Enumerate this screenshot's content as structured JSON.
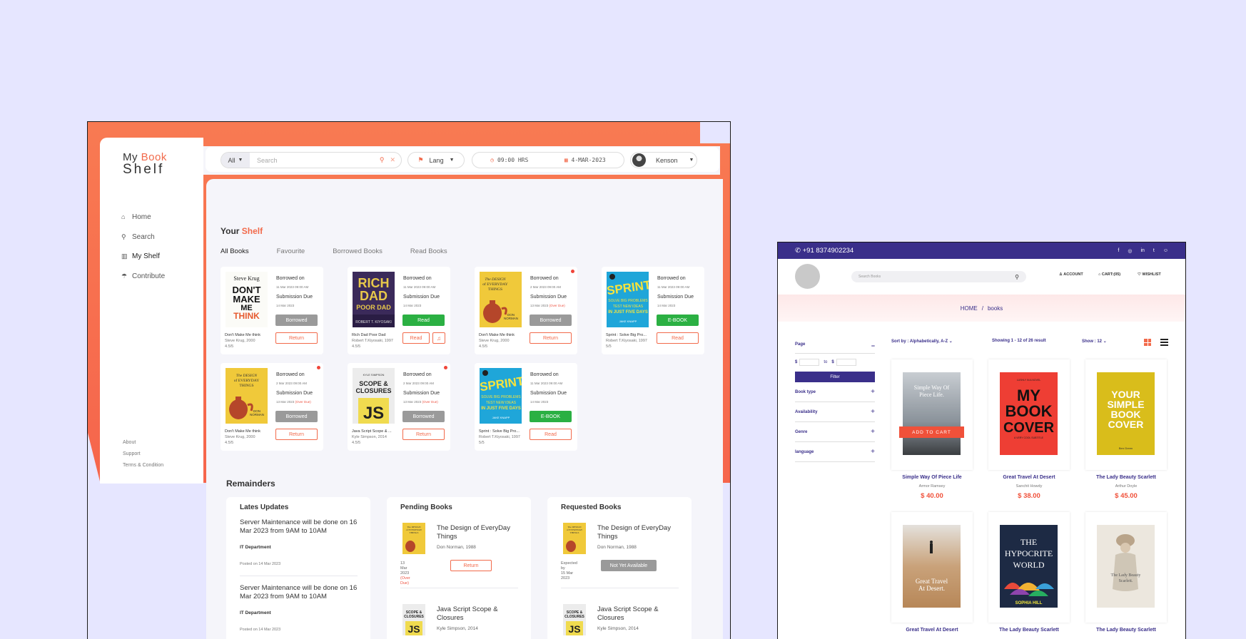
{
  "shelf_app": {
    "logo": {
      "my": "My ",
      "book": "Book",
      "shelf": "Shelf"
    },
    "nav": [
      {
        "label": "Home",
        "icon": "home-icon"
      },
      {
        "label": "Search",
        "icon": "search-icon"
      },
      {
        "label": "My Shelf",
        "icon": "bookshelf-icon"
      },
      {
        "label": "Contribute",
        "icon": "contribute-icon"
      }
    ],
    "footer_links": [
      "About",
      "Support",
      "Terms & Condition"
    ],
    "search": {
      "category": "All",
      "placeholder": "Search"
    },
    "lang": "Lang",
    "time": "09:00 HRS",
    "date": "4-MAR-2023",
    "user": "Kenson",
    "shelf_title": {
      "your": "Your ",
      "shelf": "Shelf"
    },
    "tabs": [
      "All Books",
      "Favourite",
      "Borrowed Books",
      "Read Books"
    ],
    "labels": {
      "borrowed_on": "Borrowed on",
      "submission_due": "Submission Due",
      "over_due": "(Over Due)",
      "return": "Return",
      "read": "Read",
      "borrowed": "Borrowed",
      "ebook": "E-BOOK"
    },
    "cards": [
      {
        "title": "Don't Make Me think",
        "author": "Steve Krug, 2000",
        "rating": "4.5/5",
        "borrowed": "11 Mar 2023 09:00 AM",
        "due": "14 Mar 2023",
        "due_over": "",
        "status": "Borrowed",
        "action": "Return"
      },
      {
        "title": "Rich Dad Poor Dad",
        "author": "Robert T.Kiyosaki, 1997",
        "rating": "4.5/5",
        "borrowed": "11 Mar 2023 09:00 AM",
        "due": "14 Mar 2023",
        "due_over": "",
        "status": "Read",
        "action": "Read"
      },
      {
        "title": "Don't Make Me think",
        "author": "Steve Krug, 2000",
        "rating": "4.5/5",
        "borrowed": "2 Mar 2023 09:00 AM",
        "due": "13 Mar 2023",
        "due_over": "(Over Due)",
        "status": "Borrowed",
        "action": "Return"
      },
      {
        "title": "Sprint : Solve Big Pro...",
        "author": "Robert T.Kiyosaki, 1997",
        "rating": "5/5",
        "borrowed": "11 Mar 2023 09:00 AM",
        "due": "14 Mar 2023",
        "due_over": "",
        "status": "E-BOOK",
        "action": "Read"
      },
      {
        "title": "Don't Make Me think",
        "author": "Steve Krug, 2000",
        "rating": "4.5/5",
        "borrowed": "2 Mar 2023 09:00 AM",
        "due": "13 Mar 2023",
        "due_over": "(Over Due)",
        "status": "Borrowed",
        "action": "Return"
      },
      {
        "title": "Java Script Scope & ...",
        "author": "Kyle Simpson, 2014",
        "rating": "4.5/5",
        "borrowed": "2 Mar 2023 09:00 AM",
        "due": "13 Mar 2023",
        "due_over": "(Over Due)",
        "status": "Borrowed",
        "action": "Return"
      },
      {
        "title": "Sprint : Solve Big Pro...",
        "author": "Robert T.Kiyosaki, 1997",
        "rating": "5/5",
        "borrowed": "11 Mar 2023 09:00 AM",
        "due": "14 Mar 2023",
        "due_over": "",
        "status": "E-BOOK",
        "action": "Read"
      }
    ],
    "covers": {
      "dmmt": {
        "top": "Steve Krug",
        "big": "DON'T MAKE ME THINK"
      },
      "rdpd": {
        "big": "RICH DAD POOR DAD",
        "author": "ROBERT T. KIYOSAKI"
      },
      "doet": {
        "big": "The DESIGN of EVERYDAY THINGS",
        "author": "DON NORMAN"
      },
      "sprint": {
        "big": "SPRINT",
        "author": "JAKE KNAPP"
      },
      "js": {
        "top": "KYLE SIMPSON",
        "big": "SCOPE & CLOSURES",
        "js": "JS"
      }
    },
    "remainders_title": "Remainders",
    "latest": {
      "title": "Lates Updates",
      "items": [
        {
          "text": "Server Maintenance will be done on 16 Mar 2023 from 9AM to 10AM",
          "dept": "IT Department",
          "posted": "Posted on 14 Mar 2023"
        },
        {
          "text": "Server Maintenance will be done on 16 Mar 2023 from 9AM to 10AM",
          "dept": "IT Department",
          "posted": "Posted on 14 Mar 2023"
        }
      ]
    },
    "pending": {
      "title": "Pending Books",
      "items": [
        {
          "title": "The Design of EveryDay Things",
          "author": "Don Norman, 1988",
          "date": "13 Mar 2023",
          "note": "(Over Due)",
          "button": "Return"
        },
        {
          "title": "Java Script Scope & Closures",
          "author": "Kyle Simpson, 2014"
        }
      ]
    },
    "requested": {
      "title": "Requested Books",
      "items": [
        {
          "title": "The Design of EveryDay Things",
          "author": "Don Norman, 1988",
          "date1": "Expected by",
          "date2": "15 Mar 2023",
          "button": "Not Yet Available"
        },
        {
          "title": "Java Script Scope & Closures",
          "author": "Kyle Simpson, 2014"
        }
      ]
    }
  },
  "store_app": {
    "phone": "+91 8374902234",
    "social": [
      "f",
      "◎",
      "in",
      "t",
      "☺"
    ],
    "search_placeholder": "Search Books",
    "account": "ACCOUNT",
    "cart": "CART:(05)",
    "wishlist": "WISHLIST",
    "breadcrumb": {
      "home": "HOME",
      "sep": "/",
      "current": "books"
    },
    "filters": {
      "page": "Page",
      "dollar": "$",
      "to": "to",
      "filter_btn": "Filter",
      "groups": [
        "Book type",
        "Availability",
        "Genre",
        "language"
      ]
    },
    "sort": "Sort by : Alphabetically, A-Z",
    "showing": "Showing 1 - 12 of 26 result",
    "show": "Show : 12",
    "add_to_cart": "ADD TO CART",
    "products": [
      {
        "title": "Simple Way Of Piece Life",
        "author": "Armor Ramsey",
        "price": "$ 40.00",
        "cover": "Simple Way Of Piece Life."
      },
      {
        "title": "Great Travel At Desert",
        "author": "Sanchit Howdy",
        "price": "$ 38.00",
        "cover": "MY BOOK COVER"
      },
      {
        "title": "The Lady Beauty Scarlett",
        "author": "Arthur Doyle",
        "price": "$ 45.00",
        "cover": "YOUR SIMPLE BOOK COVER"
      },
      {
        "title": "Great Travel At Desert",
        "cover": "Great Travel At Desert."
      },
      {
        "title": "The Lady Beauty Scarlett",
        "cover": "THE HYPOCRITE WORLD"
      },
      {
        "title": "The Lady Beauty Scarlett",
        "cover": "The Lady Beauty Scarlett."
      }
    ],
    "cover_small": {
      "hill": "SOPHIA HILL",
      "mybook_top": "LUSHLY IN A NOVEL",
      "mybook_bottom": "A VERY COOL SUBTITLE",
      "author_name": "Ben Green"
    }
  }
}
